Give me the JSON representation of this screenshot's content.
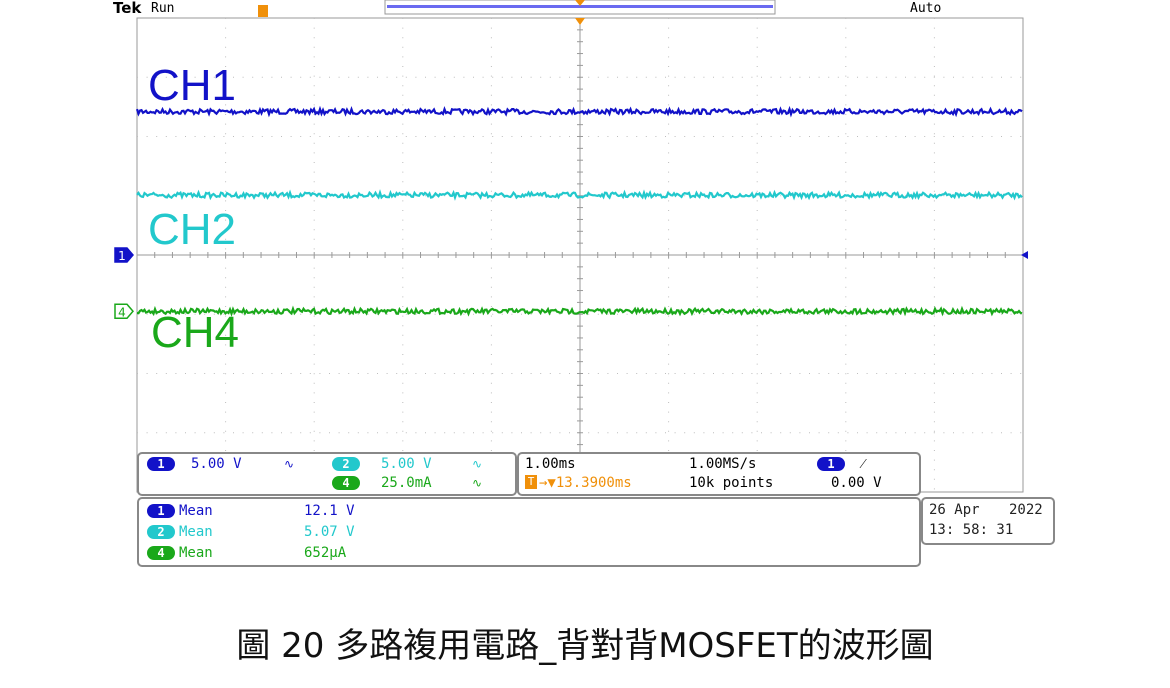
{
  "scope": {
    "brand": "Tek",
    "state": "Run",
    "trigger_mode": "Auto",
    "trigger_marker": "T"
  },
  "colors": {
    "ch1": "#1212c8",
    "ch2": "#22c8cc",
    "ch4": "#1aa81a",
    "trigger": "#f0900a"
  },
  "chart_data": {
    "type": "line",
    "title": "",
    "xlabel": "",
    "ylabel": "",
    "grid": true,
    "divisions": {
      "x": 10,
      "y": 8
    },
    "xlim": [
      -5,
      5
    ],
    "ylim": [
      -4,
      4
    ],
    "series": [
      {
        "name": "CH1",
        "channel": "1",
        "color": "#1212c8",
        "level_div": 2.42,
        "ground_div": 0,
        "values": []
      },
      {
        "name": "CH2",
        "channel": "2",
        "color": "#22c8cc",
        "level_div": 1.01,
        "ground_div": 0,
        "values": []
      },
      {
        "name": "CH4",
        "channel": "4",
        "color": "#1aa81a",
        "level_div": -0.95,
        "ground_div": -0.95,
        "values": []
      }
    ]
  },
  "ground_markers": {
    "ch1": "1",
    "ch4": "4"
  },
  "settings": {
    "ch1_badge": "1",
    "ch1_scale": "5.00 V",
    "ch2_badge": "2",
    "ch2_scale": "5.00 V",
    "ch4_badge": "4",
    "ch4_scale": "25.0mA",
    "bw_symbol": "∿"
  },
  "timebase": {
    "horizontal_scale": "1.00ms",
    "trigger_position": "→▼13.3900ms",
    "sample_rate": "1.00MS/s",
    "record_length": "10k points",
    "trigger_source_badge": "1",
    "trigger_slope": "⁄",
    "trigger_level": "0.00 V"
  },
  "measurements": [
    {
      "badge": "1",
      "label": "Mean",
      "value": "12.1 V"
    },
    {
      "badge": "2",
      "label": "Mean",
      "value": "5.07 V"
    },
    {
      "badge": "4",
      "label": "Mean",
      "value": "652μA"
    }
  ],
  "datetime": {
    "date_day_month": "26 Apr",
    "year": "2022",
    "time": "13: 58: 31"
  },
  "caption": "圖 20 多路複用電路_背對背MOSFET的波形圖"
}
